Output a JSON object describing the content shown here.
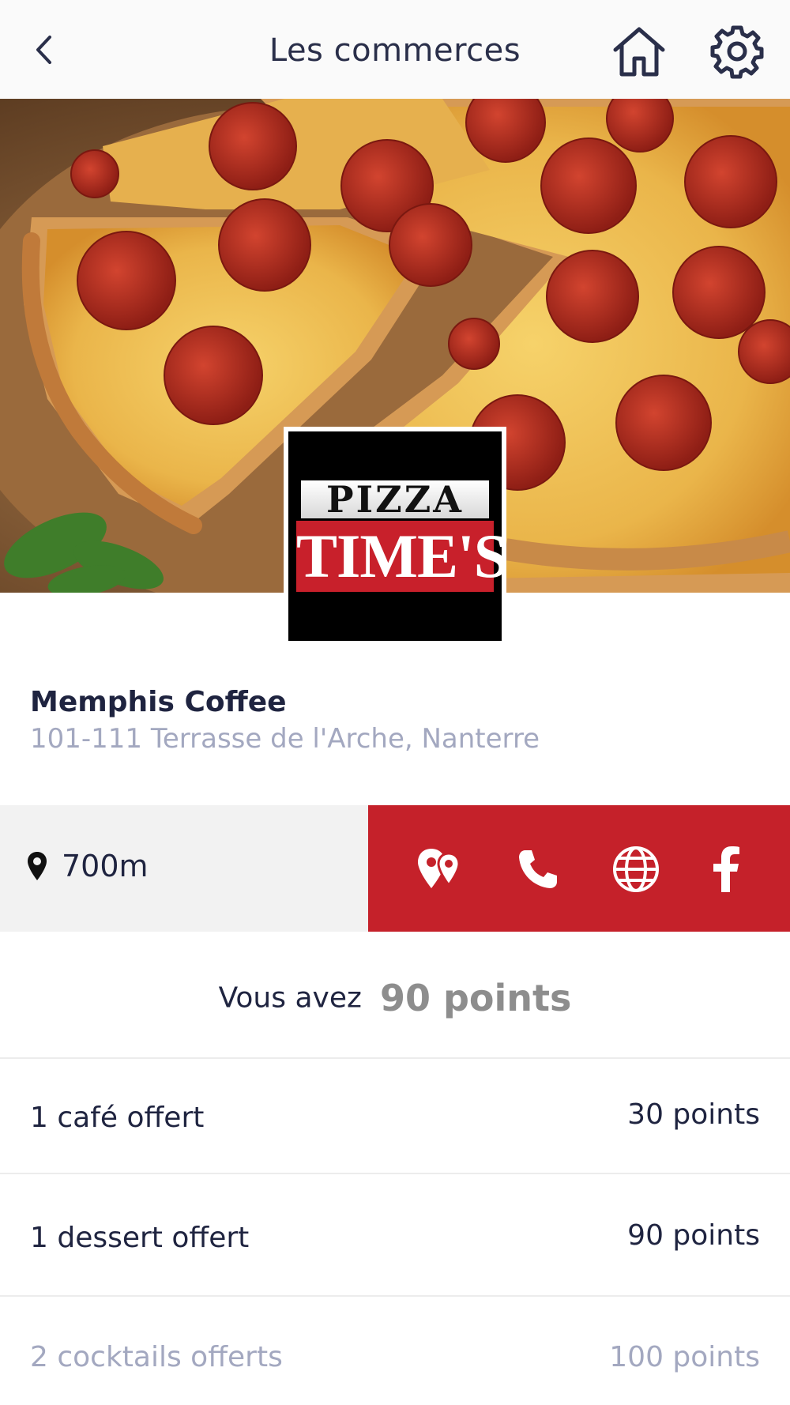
{
  "header": {
    "title": "Les commerces",
    "back_icon": "chevron-left-icon",
    "home_icon": "home-icon",
    "settings_icon": "gear-icon"
  },
  "hero": {
    "image": "pepperoni-pizza-photo"
  },
  "logo": {
    "line1": "PIZZA",
    "line2": "TIME'S",
    "brand_red": "#c8202b"
  },
  "shop": {
    "name": "Memphis Coffee",
    "address": "101-111 Terrasse de l'Arche, Nanterre"
  },
  "location": {
    "icon": "map-pin-icon",
    "distance": "700m"
  },
  "actions": {
    "background_color": "#c5212a",
    "items": [
      {
        "name": "directions-button",
        "icon": "waypoint-pins-icon"
      },
      {
        "name": "call-button",
        "icon": "phone-icon"
      },
      {
        "name": "website-button",
        "icon": "globe-icon"
      },
      {
        "name": "facebook-button",
        "icon": "facebook-icon"
      }
    ]
  },
  "points": {
    "prefix": "Vous avez",
    "value": "90 points"
  },
  "rewards": [
    {
      "label": "1 café offert",
      "points": "30 points",
      "available": true
    },
    {
      "label": "1 dessert offert",
      "points": "90 points",
      "available": true
    },
    {
      "label": "2 cocktails offerts",
      "points": "100 points",
      "available": false
    }
  ]
}
